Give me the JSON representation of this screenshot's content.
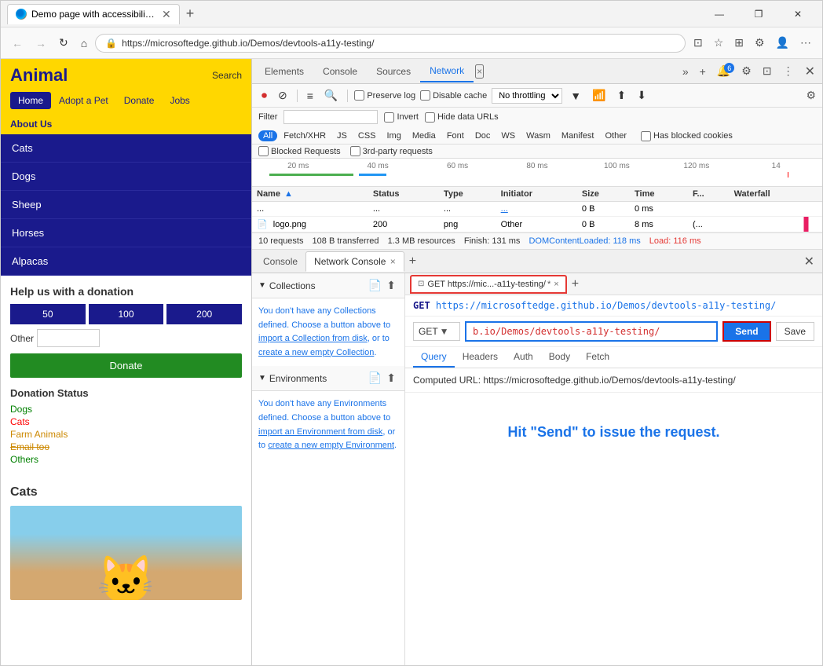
{
  "browser": {
    "tab_title": "Demo page with accessibility iss",
    "address": "https://microsoftedge.github.io/Demos/devtools-a11y-testing/",
    "new_tab_label": "+",
    "window_controls": {
      "minimize": "—",
      "maximize": "❐",
      "close": "✕"
    }
  },
  "devtools": {
    "tabs": [
      "Elements",
      "Console",
      "Sources",
      "Network",
      "×",
      "»",
      "+"
    ],
    "active_tab": "Network",
    "toolbar": {
      "record": "⏺",
      "stop": "⊘",
      "clear": "≡",
      "search": "🔍",
      "preserve_log": "Preserve log",
      "disable_cache": "Disable cache",
      "throttle": "No throttling",
      "settings_icon": "⚙"
    },
    "filter": {
      "label": "Filter",
      "invert": "Invert",
      "hide_data_urls": "Hide data URLs",
      "types": [
        "All",
        "Fetch/XHR",
        "JS",
        "CSS",
        "Img",
        "Media",
        "Font",
        "Doc",
        "WS",
        "Wasm",
        "Manifest",
        "Other"
      ],
      "active_type": "All",
      "has_blocked_cookies": "Has blocked cookies",
      "blocked_requests": "Blocked Requests",
      "third_party": "3rd-party requests"
    },
    "timeline": {
      "labels": [
        "20 ms",
        "40 ms",
        "60 ms",
        "80 ms",
        "100 ms",
        "120 ms",
        "14"
      ]
    },
    "table": {
      "columns": [
        "Name",
        "Status",
        "Type",
        "Initiator",
        "Size",
        "Time",
        "F...",
        "Waterfall"
      ],
      "rows": [
        {
          "name": "...",
          "status": "...",
          "type": "...",
          "initiator": "...",
          "size": "0 B",
          "time": "0 ms"
        },
        {
          "name": "logo.png",
          "status": "200",
          "type": "png",
          "initiator": "Other",
          "size": "0 B",
          "time": "8 ms",
          "extra": "(..."
        }
      ]
    },
    "summary": {
      "requests": "10 requests",
      "transferred": "108 B transferred",
      "resources": "1.3 MB resources",
      "finish": "Finish: 131 ms",
      "domcontent": "DOMContentLoaded: 118 ms",
      "load": "Load: 116 ms"
    },
    "bottom_tabs": {
      "console": "Console",
      "network_console": "Network Console",
      "network_console_active": true
    }
  },
  "network_console": {
    "collections_section": {
      "title": "Collections",
      "body": "You don't have any Collections defined. Choose a button above to import a Collection from disk, or to create a new empty Collection."
    },
    "environments_section": {
      "title": "Environments",
      "body": "You don't have any Environments defined. Choose a button above to import an Environment from disk, or to create a new empty Environment."
    },
    "request_tab": {
      "label": "GET https://mic...-a11y-testing/",
      "asterisk": "*"
    },
    "request_header": "GET https://microsoftedge.github.io/Demos/devtools-a11y-testing/",
    "method": "GET",
    "url_input": "b.io/Demos/devtools-a11y-testing/",
    "send_label": "Send",
    "save_label": "Save",
    "sub_tabs": [
      "Query",
      "Headers",
      "Auth",
      "Body",
      "Fetch"
    ],
    "active_sub_tab": "Query",
    "computed_url": "Computed URL: https://microsoftedge.github.io/Demos/devtools-a11y-testing/",
    "hit_send_msg": "Hit \"Send\" to issue the request."
  },
  "website": {
    "logo": "Animal",
    "search_label": "Search",
    "nav_items": [
      "Home",
      "Adopt a Pet",
      "Donate",
      "Jobs"
    ],
    "active_nav": "Home",
    "about": "About Us",
    "list_items": [
      "Cats",
      "Dogs",
      "Sheep",
      "Horses",
      "Alpacas"
    ],
    "donation_title": "Help us with a donation",
    "donation_amounts": [
      "50",
      "100",
      "200"
    ],
    "other_label": "Other",
    "donate_btn": "Donate",
    "donation_status_title": "Donation Status",
    "donation_statuses": [
      {
        "label": "Dogs",
        "class": "dogs"
      },
      {
        "label": "Cats",
        "class": "cats"
      },
      {
        "label": "Farm Animals",
        "class": "farm"
      },
      {
        "label": "Email too",
        "class": "email"
      },
      {
        "label": "Others",
        "class": "others"
      }
    ],
    "cats_title": "Cats"
  }
}
